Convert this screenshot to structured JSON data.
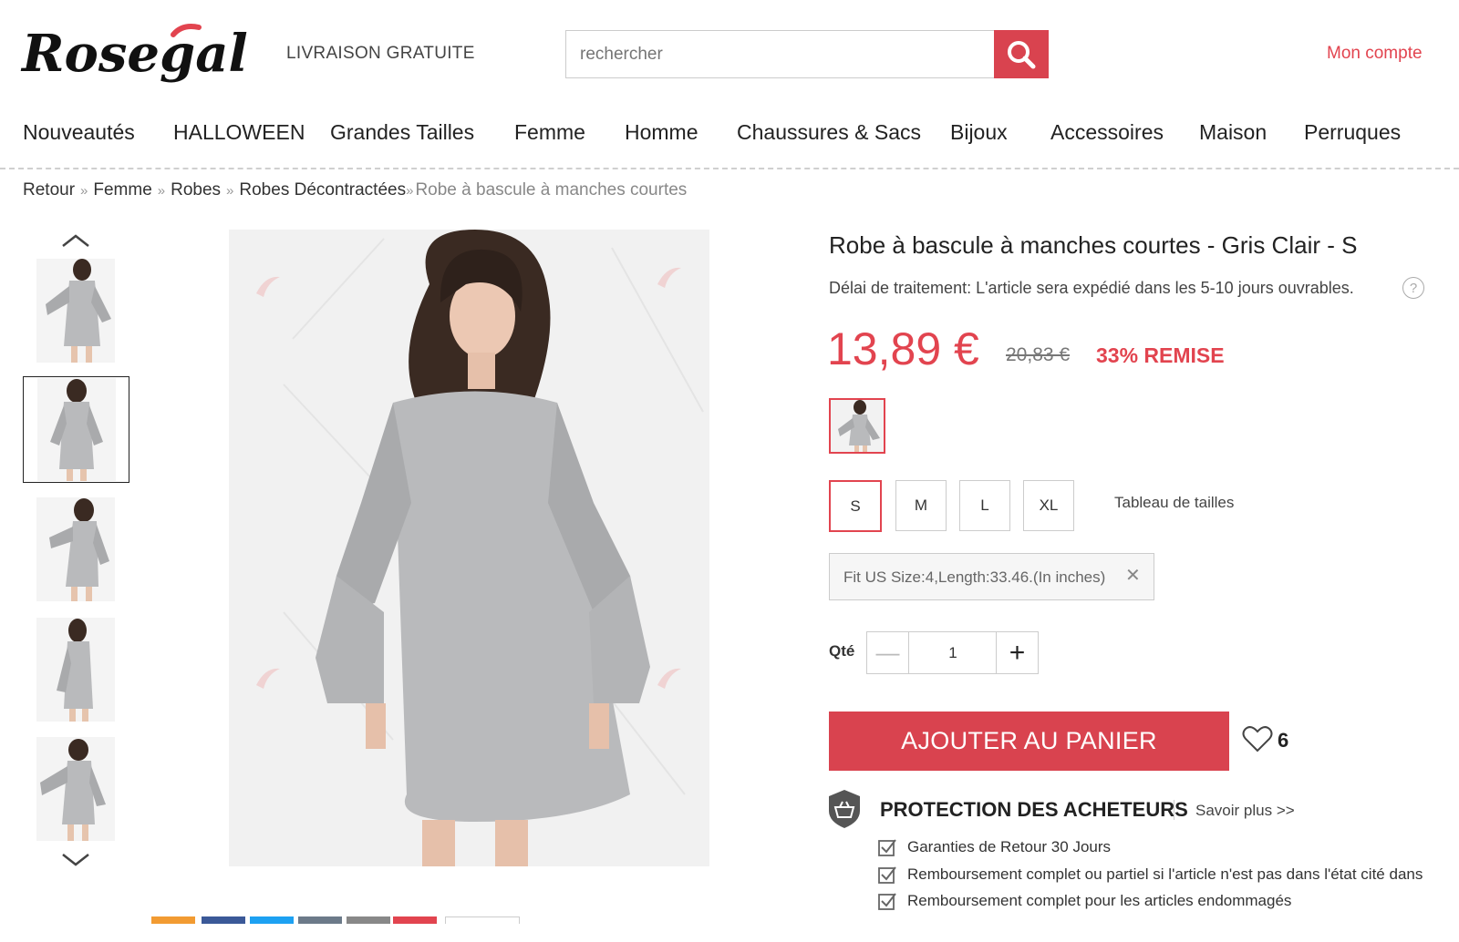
{
  "header": {
    "logo_text": "Rosegal",
    "tagline": "LIVRAISON GRATUITE",
    "search_placeholder": "rechercher",
    "account_label": "Mon compte"
  },
  "nav": {
    "items": [
      "Nouveautés",
      "HALLOWEEN",
      "Grandes Tailles",
      "Femme",
      "Homme",
      "Chaussures & Sacs",
      "Bijoux",
      "Accessoires",
      "Maison",
      "Perruques"
    ]
  },
  "breadcrumb": {
    "items": [
      "Retour",
      "Femme",
      "Robes",
      "Robes Décontractées"
    ],
    "separator": "»",
    "current": "Robe à bascule à manches courtes"
  },
  "product": {
    "title": "Robe à bascule à manches courtes - Gris Clair - S",
    "processing_label": "Délai de traitement:",
    "processing_text": "L'article sera expédié dans les 5-10 jours ouvrables.",
    "price": "13,89 €",
    "old_price": "20,83 €",
    "discount": "33% REMISE",
    "sizes": [
      "S",
      "M",
      "L",
      "XL"
    ],
    "selected_size": "S",
    "size_chart_label": "Tableau de tailles",
    "fit_note": "Fit US Size:4,Length:33.46.(In inches)",
    "qty_label": "Qté",
    "qty_value": "1",
    "add_to_cart": "AJOUTER AU PANIER",
    "wishlist_count": "6"
  },
  "protection": {
    "title": "PROTECTION DES ACHETEURS",
    "link": "Savoir plus >>",
    "items": [
      "Garanties de Retour 30 Jours",
      "Remboursement complet ou partiel si l'article n'est pas dans l'état cité dans",
      "Remboursement complet pour les articles endommagés"
    ]
  },
  "colors": {
    "accent": "#e2444f",
    "button": "#d9434f",
    "dress": "#b9babc"
  }
}
